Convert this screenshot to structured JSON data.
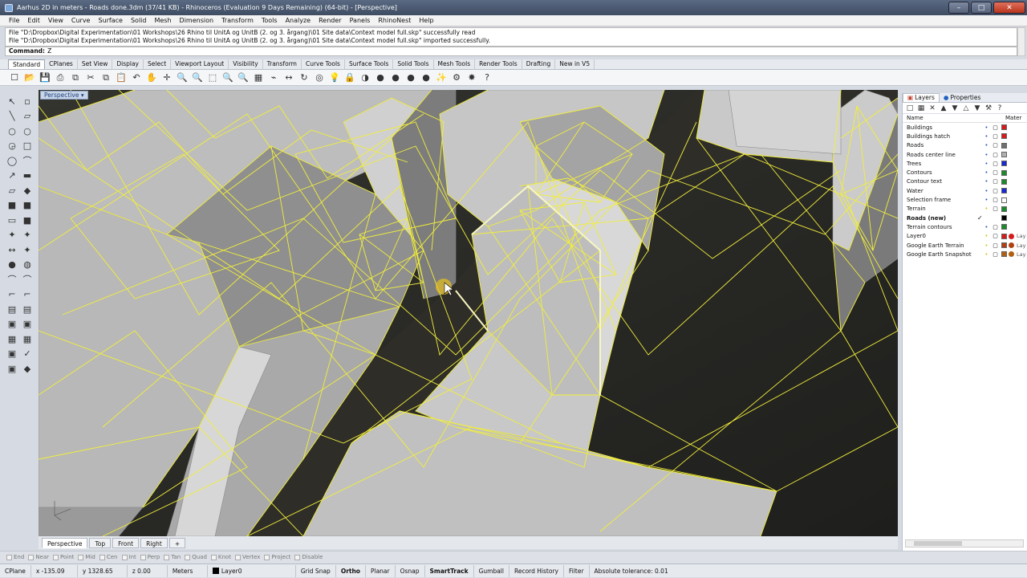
{
  "window": {
    "title": "Aarhus 2D in meters - Roads done.3dm (37/41 KB) - Rhinoceros (Evaluation 9 Days Remaining) (64-bit) - [Perspective]",
    "min": "–",
    "max": "□",
    "close": "✕"
  },
  "menu": [
    "File",
    "Edit",
    "View",
    "Curve",
    "Surface",
    "Solid",
    "Mesh",
    "Dimension",
    "Transform",
    "Tools",
    "Analyze",
    "Render",
    "Panels",
    "RhinoNest",
    "Help"
  ],
  "command": {
    "history": [
      "File \"D:\\Dropbox\\Digital Experimentation\\01 Workshops\\26 Rhino til UnitA og UnitB (2. og 3. årgang)\\01 Site data\\Context model full.skp\" successfully read",
      "File \"D:\\Dropbox\\Digital Experimentation\\01 Workshops\\26 Rhino til UnitA og UnitB (2. og 3. årgang)\\01 Site data\\Context model full.skp\" imported successfully."
    ],
    "label": "Command:",
    "value": "Z"
  },
  "toolbar_tabs": [
    "Standard",
    "CPlanes",
    "Set View",
    "Display",
    "Select",
    "Viewport Layout",
    "Visibility",
    "Transform",
    "Curve Tools",
    "Surface Tools",
    "Solid Tools",
    "Mesh Tools",
    "Render Tools",
    "Drafting",
    "New in V5"
  ],
  "toolbar_icons": [
    "☐",
    "📂",
    "💾",
    "⎙",
    "⧉",
    "✂",
    "⧉",
    "📋",
    "↶",
    "✋",
    "✛",
    "🔍",
    "🔍",
    "⬚",
    "🔍",
    "🔍",
    "▦",
    "⌁",
    "↔",
    "↻",
    "◎",
    "💡",
    "🔒",
    "◑",
    "●",
    "●",
    "●",
    "●",
    "✨",
    "⚙",
    "✸",
    "?"
  ],
  "left_tools": [
    "↖",
    "▫",
    "╲",
    "▱",
    "○",
    "○",
    "◶",
    "□",
    "◯",
    "⌒",
    "↗",
    "▬",
    "▱",
    "◆",
    "■",
    "■",
    "▭",
    "■",
    "✦",
    "✦",
    "↔",
    "✦",
    "●",
    "◍",
    "⌒",
    "⌒",
    "⌐",
    "⌐",
    "▤",
    "▤",
    "▣",
    "▣",
    "▦",
    "▦",
    "▣",
    "✓",
    "▣",
    "◆"
  ],
  "viewport": {
    "label": "Perspective ▾"
  },
  "viewport_tabs": [
    "Perspective",
    "Top",
    "Front",
    "Right",
    "+"
  ],
  "osnaps": [
    "End",
    "Near",
    "Point",
    "Mid",
    "Cen",
    "Int",
    "Perp",
    "Tan",
    "Quad",
    "Knot",
    "Vertex",
    "Project",
    "Disable"
  ],
  "status": {
    "cplane": "CPlane",
    "x": "x -135.09",
    "y": "y 1328.65",
    "z": "z 0.00",
    "units": "Meters",
    "layer": "Layer0",
    "grid": "Grid Snap",
    "ortho": "Ortho",
    "planar": "Planar",
    "osnap": "Osnap",
    "smarttrack": "SmartTrack",
    "gumball": "Gumball",
    "history": "Record History",
    "filter": "Filter",
    "tolerance": "Absolute tolerance: 0.01"
  },
  "panel": {
    "tabs": [
      "Layers",
      "Properties"
    ],
    "col_name": "Name",
    "col_material": "Mater",
    "layers": [
      {
        "name": "Buildings",
        "check": "",
        "color": "#d61b1b",
        "mat": ""
      },
      {
        "name": "Buildings hatch",
        "check": "",
        "color": "#d61b1b",
        "mat": ""
      },
      {
        "name": "Roads",
        "check": "",
        "color": "#707070",
        "mat": ""
      },
      {
        "name": "Roads center line",
        "check": "",
        "color": "#b0b0b0",
        "mat": ""
      },
      {
        "name": "Trees",
        "check": "",
        "color": "#1a2ad0",
        "mat": ""
      },
      {
        "name": "Contours",
        "check": "",
        "color": "#1a8a2a",
        "mat": ""
      },
      {
        "name": "Contour text",
        "check": "",
        "color": "#1a8a2a",
        "mat": ""
      },
      {
        "name": "Water",
        "check": "",
        "color": "#1a2ad0",
        "mat": ""
      },
      {
        "name": "Selection frame",
        "check": "",
        "color": "#ffffff",
        "mat": ""
      },
      {
        "name": "Terrain",
        "check": "",
        "color": "#1a8a2a",
        "mat": ""
      },
      {
        "name": "Roads (new)",
        "check": "✓",
        "color": "#000000",
        "mat": "",
        "current": true
      },
      {
        "name": "Terrain contours",
        "check": "",
        "color": "#1a8a2a",
        "mat": ""
      },
      {
        "name": "Layer0",
        "check": "",
        "color": "#d61b1b",
        "mat": "Lay"
      },
      {
        "name": "Google Earth Terrain",
        "check": "",
        "color": "#b04010",
        "mat": "Lay"
      },
      {
        "name": "Google Earth Snapshot",
        "check": "",
        "color": "#b06010",
        "mat": "Lay"
      }
    ]
  },
  "colors": {
    "wire": "#f2ef3a",
    "building": "#bdbdbd",
    "ground": "#2a2a27"
  }
}
